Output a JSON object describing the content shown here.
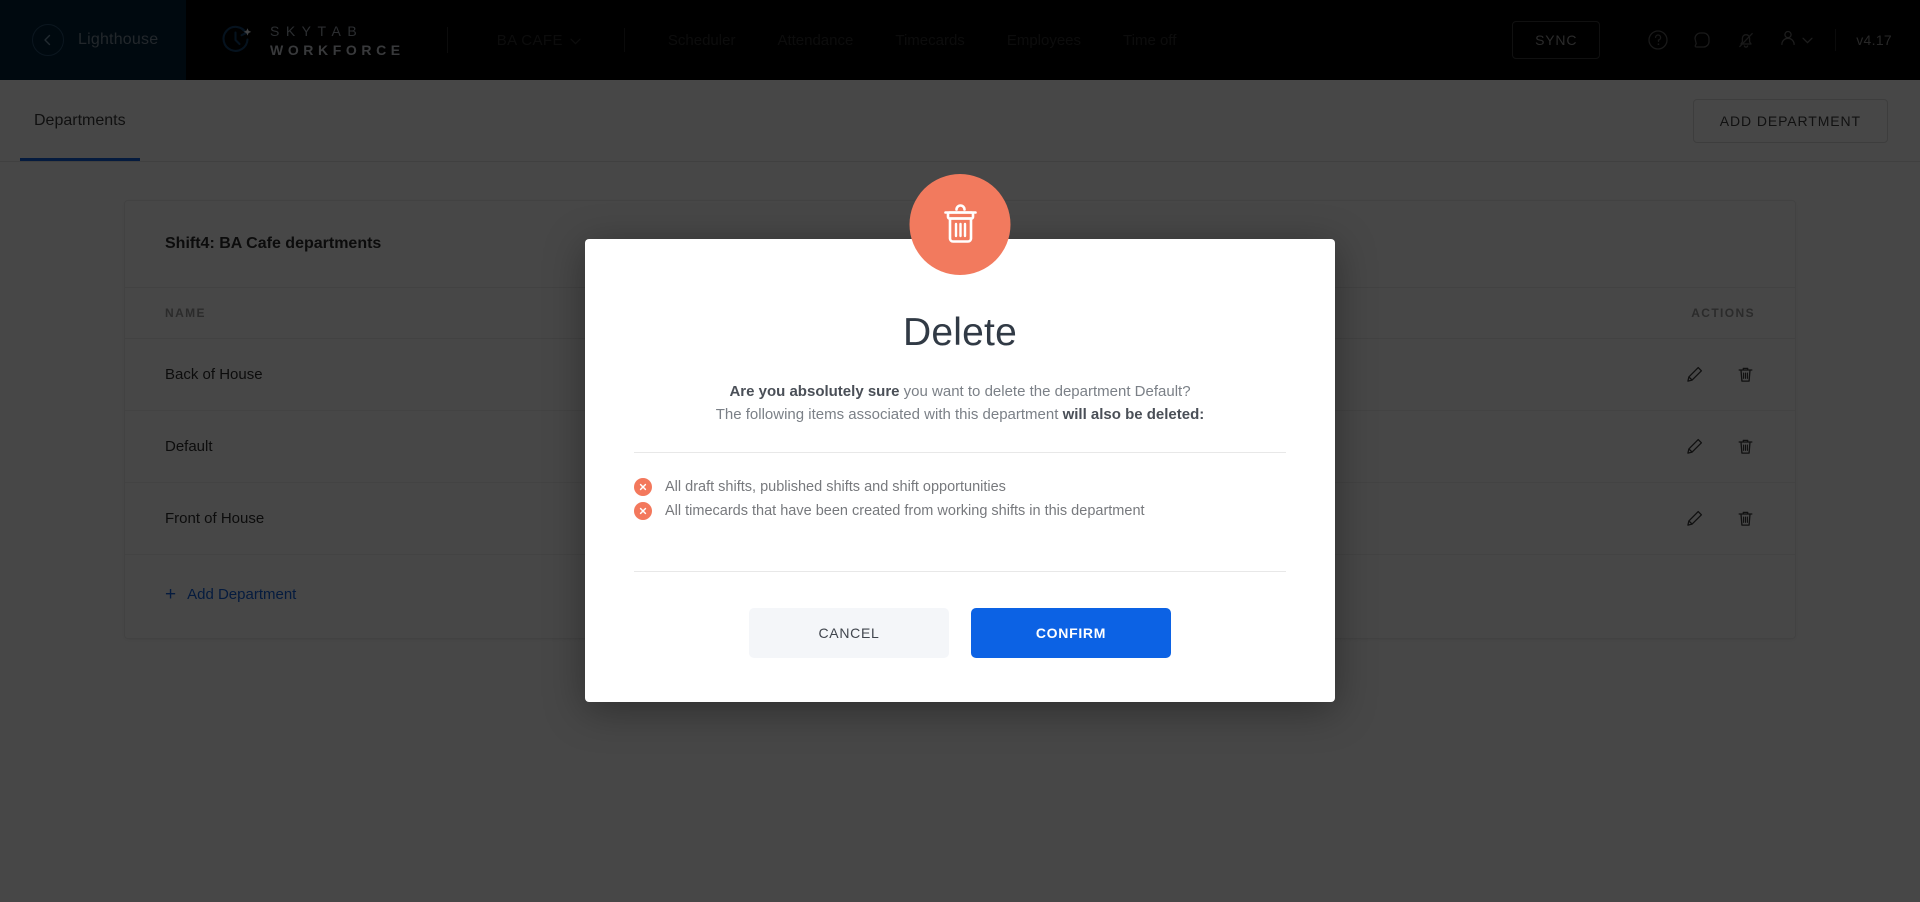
{
  "topbar": {
    "back_label": "Lighthouse",
    "back_icon": "chevron-left-icon",
    "brand_top": "SKYTAB",
    "brand_bottom": "WORKFORCE",
    "location_selector": "BA CAFE",
    "nav_items": [
      {
        "label": "Scheduler"
      },
      {
        "label": "Attendance"
      },
      {
        "label": "Timecards"
      },
      {
        "label": "Employees"
      },
      {
        "label": "Time off"
      }
    ],
    "sync_label": "SYNC",
    "icons": [
      "help-circle-icon",
      "chat-bubble-icon",
      "notifications-off-icon",
      "user-account-icon"
    ],
    "version": "v4.17"
  },
  "subheader": {
    "tabs": [
      {
        "label": "Departments",
        "active": true
      }
    ],
    "add_department_button": "ADD DEPARTMENT"
  },
  "departments_card": {
    "title": "Shift4: BA Cafe departments",
    "columns": {
      "name": "NAME",
      "actions": "ACTIONS"
    },
    "rows": [
      {
        "name": "Back of House"
      },
      {
        "name": "Default"
      },
      {
        "name": "Front of House"
      }
    ],
    "row_action_icons": [
      "edit-pencil-icon",
      "delete-trash-icon"
    ],
    "add_link": "Add Department",
    "add_link_icon": "plus-icon"
  },
  "modal": {
    "badge_icon": "trash-can-icon",
    "title": "Delete",
    "line1_bold": "Are you absolutely sure",
    "line1_rest": " you want to delete the department Default?",
    "line2_rest": "The following items associated with this department ",
    "line2_bold": "will also be deleted:",
    "bullets": [
      {
        "icon": "x-circle-icon",
        "text": "All draft shifts, published shifts and shift opportunities"
      },
      {
        "icon": "x-circle-icon",
        "text": "All timecards that have been created from working shifts in this department"
      }
    ],
    "cancel_label": "CANCEL",
    "confirm_label": "CONFIRM"
  },
  "colors": {
    "accent_blue": "#0c62e4",
    "danger_salmon": "#f27a5e",
    "topbar_black": "#000000",
    "back_zone_navy": "#022136",
    "overlay": "rgba(0,0,0,0.72)"
  }
}
